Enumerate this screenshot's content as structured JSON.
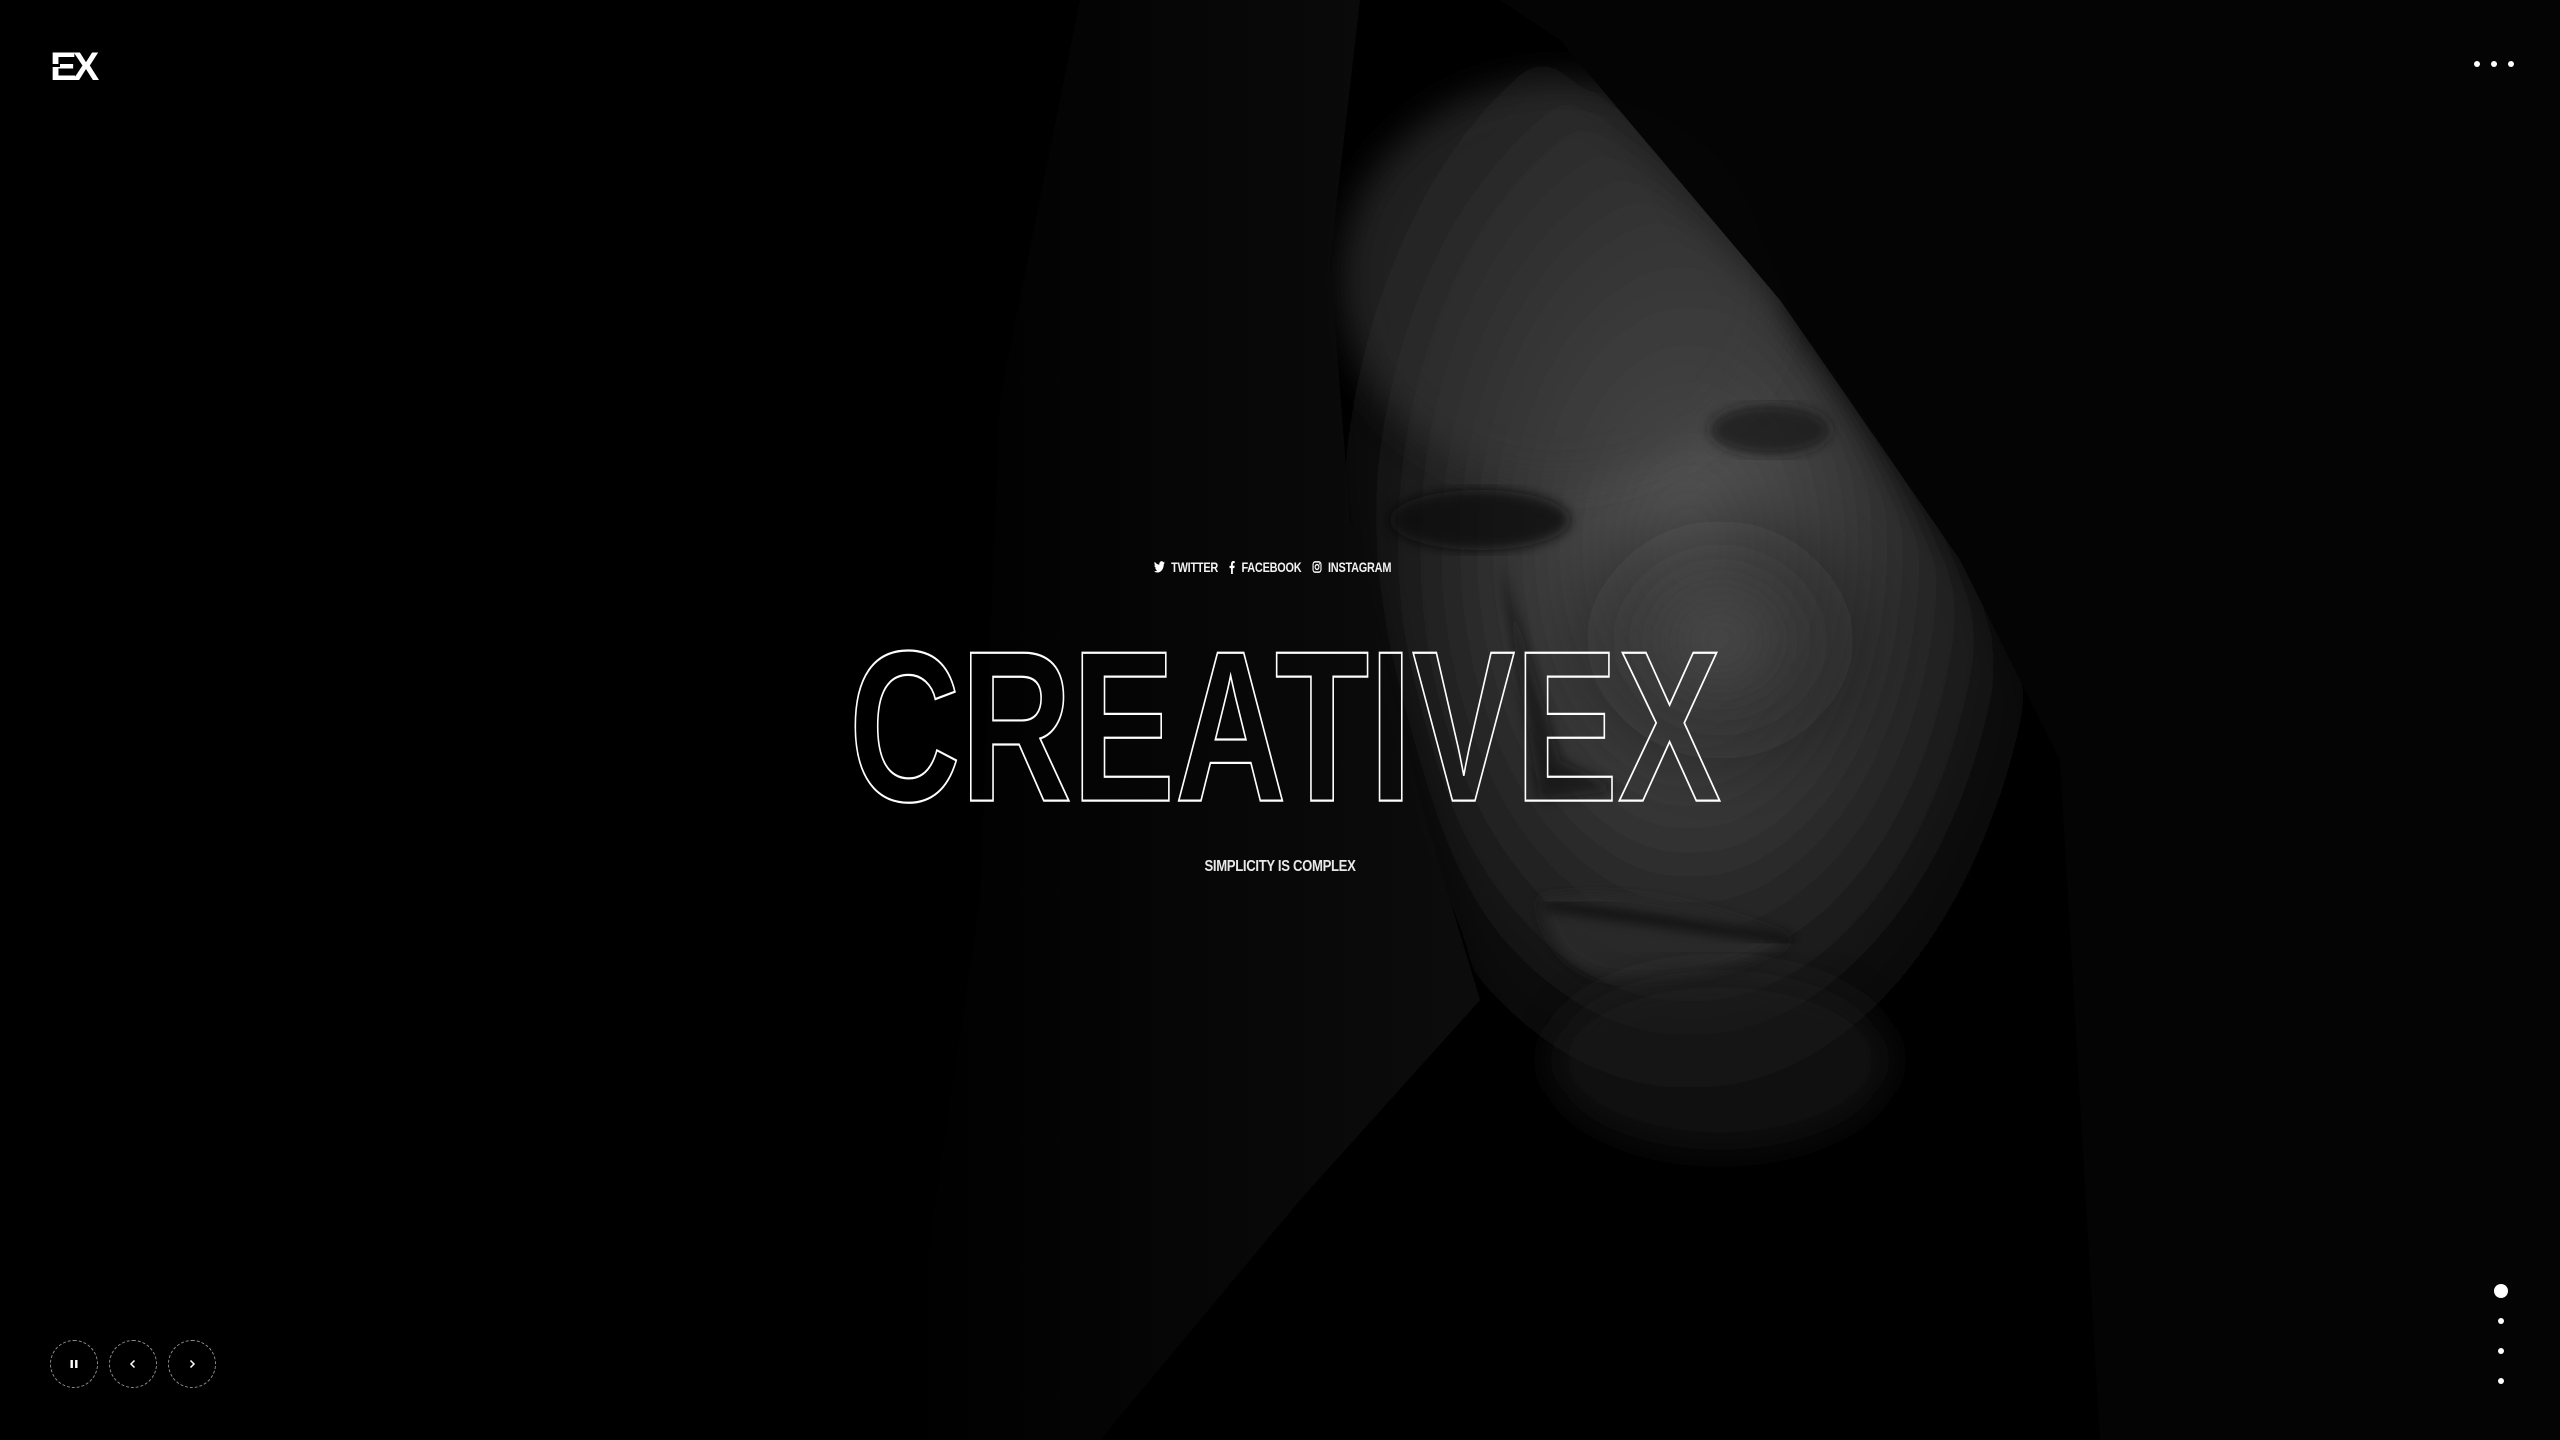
{
  "brand": {
    "logo_text": "EX"
  },
  "header": {
    "menu_icon": "more-horizontal-icon"
  },
  "hero": {
    "socials": [
      {
        "label": "TWITTER",
        "icon": "twitter-icon"
      },
      {
        "label": "FACEBOOK",
        "icon": "facebook-icon"
      },
      {
        "label": "INSTAGRAM",
        "icon": "instagram-icon"
      }
    ],
    "title": "CREATIVEX",
    "tagline": "SIMPLICITY IS COMPLEX"
  },
  "slider": {
    "controls": [
      {
        "name": "pause",
        "icon": "pause-icon"
      },
      {
        "name": "previous",
        "icon": "chevron-left-icon"
      },
      {
        "name": "next",
        "icon": "chevron-right-icon"
      }
    ],
    "slide_count": 4,
    "active_slide": 1
  },
  "colors": {
    "background": "#000000",
    "text": "#ffffff"
  }
}
